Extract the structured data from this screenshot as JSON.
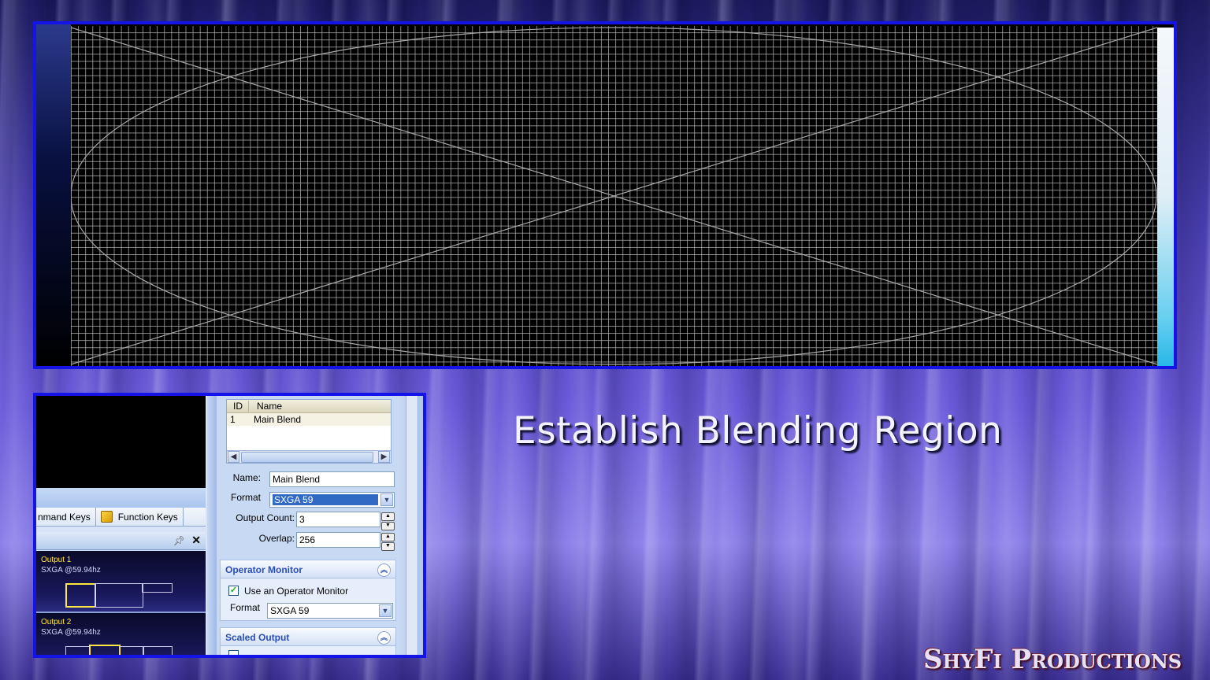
{
  "headline": "Establish Blending Region",
  "brand": "ShyFi Productions",
  "tabs": [
    {
      "label": "nmand Keys"
    },
    {
      "label": "Function Keys"
    }
  ],
  "outputs": [
    {
      "name": "Output 1",
      "format": "SXGA @59.94hz"
    },
    {
      "name": "Output 2",
      "format": "SXGA @59.94hz"
    }
  ],
  "blend_list": {
    "headers": [
      "ID",
      "Name"
    ],
    "rows": [
      [
        "1",
        "Main Blend"
      ]
    ]
  },
  "form": {
    "name_label": "Name:",
    "name_value": "Main Blend",
    "format_label": "Format",
    "format_value": "SXGA 59",
    "output_count_label": "Output Count:",
    "output_count_value": "3",
    "overlap_label": "Overlap:",
    "overlap_value": "256"
  },
  "operator_monitor": {
    "title": "Operator Monitor",
    "checkbox_label": "Use an Operator Monitor",
    "checked": true,
    "format_label": "Format",
    "format_value": "SXGA 59"
  },
  "scaled_output": {
    "title": "Scaled Output"
  },
  "colors": {
    "frame": "#1414e6",
    "section_title": "#2a4fb8",
    "output_title": "#ffe640"
  }
}
